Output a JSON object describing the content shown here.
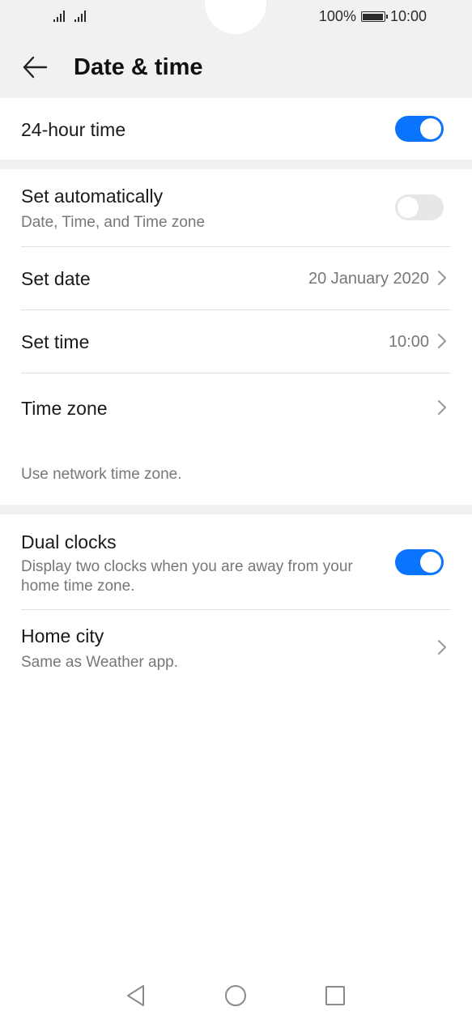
{
  "status_bar": {
    "battery_text": "100%",
    "time": "10:00"
  },
  "header": {
    "title": "Date & time"
  },
  "settings": {
    "hour24": {
      "label": "24-hour time",
      "enabled": true
    },
    "set_automatically": {
      "label": "Set automatically",
      "sub": "Date, Time, and Time zone",
      "enabled": false
    },
    "set_date": {
      "label": "Set date",
      "value": "20 January 2020"
    },
    "set_time": {
      "label": "Set time",
      "value": "10:00"
    },
    "time_zone": {
      "label": "Time zone"
    },
    "network_note": "Use network time zone.",
    "dual_clocks": {
      "label": "Dual clocks",
      "sub": "Display two clocks when you are away from your home time zone.",
      "enabled": true
    },
    "home_city": {
      "label": "Home city",
      "sub": "Same as Weather app."
    }
  },
  "colors": {
    "accent": "#0a74ff",
    "background": "#f1f1f1",
    "secondary_text": "#777777"
  },
  "icons": {
    "back": "arrow-left-icon",
    "chevron": "chevron-right-icon",
    "nav_back": "triangle-back-icon",
    "nav_home": "circle-home-icon",
    "nav_recent": "square-recent-icon"
  }
}
